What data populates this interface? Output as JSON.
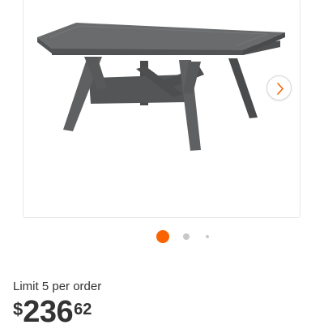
{
  "product": {
    "image_alt": "Gray square outdoor coffee table",
    "limit_text": "Limit 5 per order",
    "price": {
      "currency": "$",
      "dollars": "236",
      "cents": "62"
    }
  },
  "gallery": {
    "total_images": 3,
    "active_index": 0,
    "next_icon": "chevron-right-icon"
  },
  "colors": {
    "accent": "#f96302",
    "dot_inactive": "#c8c8c8",
    "table": "#5f6061",
    "table_dark": "#4a4b4c",
    "table_light": "#6e6f70"
  }
}
